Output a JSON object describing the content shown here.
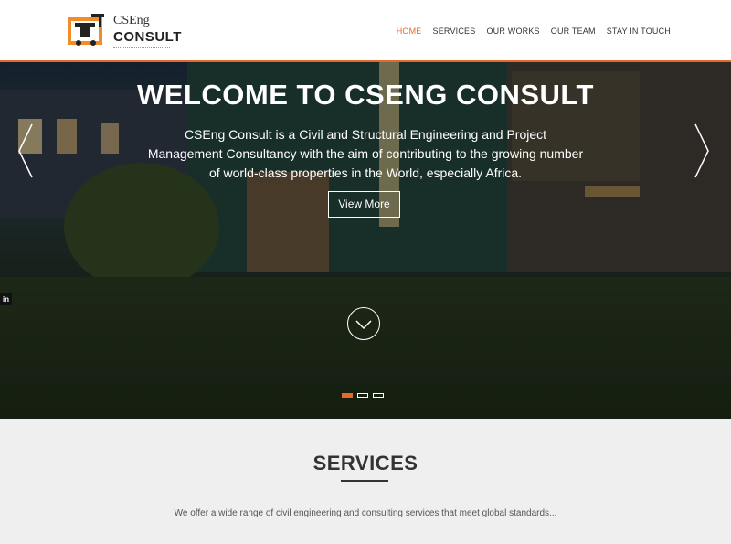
{
  "brand": {
    "top": "CSEng",
    "main": "CONSULT"
  },
  "nav": {
    "items": [
      {
        "label": "HOME",
        "active": true
      },
      {
        "label": "SERVICES",
        "active": false
      },
      {
        "label": "OUR WORKS",
        "active": false
      },
      {
        "label": "OUR TEAM",
        "active": false
      },
      {
        "label": "STAY IN TOUCH",
        "active": false
      }
    ]
  },
  "hero": {
    "title": "WELCOME TO CSENG CONSULT",
    "text": "CSEng Consult is a Civil and Structural Engineering and Project Management Consultancy with the aim of contributing to the growing number of world-class properties in the World, especially Africa.",
    "button_label": "View More",
    "slides": 3,
    "active_slide": 1,
    "social_label": "in"
  },
  "services": {
    "title": "SERVICES",
    "text": "We offer a wide range of civil engineering and consulting services that meet global standards..."
  },
  "colors": {
    "accent": "#e5692b",
    "hero_text": "#ffffff",
    "section_bg": "#efefef"
  },
  "icons": {
    "logo": "crane-logo-icon",
    "prev": "chevron-left-icon",
    "next": "chevron-right-icon",
    "scroll": "chevron-down-icon",
    "social": "linkedin-icon"
  }
}
